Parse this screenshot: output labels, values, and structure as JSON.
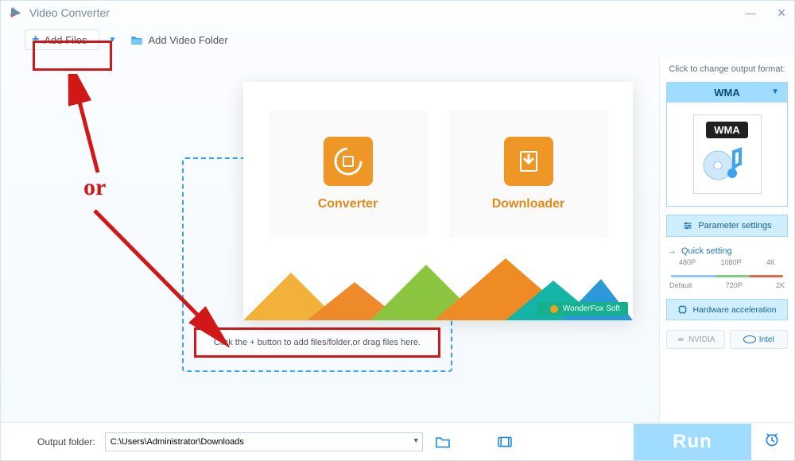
{
  "title": "Video Converter",
  "toolbar": {
    "add_files": "Add Files",
    "add_video_folder": "Add Video Folder"
  },
  "dropzone_hint": "Click the + button to add files/folder,or drag files here.",
  "welcome": {
    "converter": "Converter",
    "downloader": "Downloader",
    "brand": "WonderFox Soft"
  },
  "right": {
    "hint": "Click to change output format:",
    "format_label": "WMA",
    "format_badge": "WMA",
    "param_settings": "Parameter settings",
    "quick_setting": "Quick setting",
    "q_top": [
      "480P",
      "1080P",
      "4K"
    ],
    "q_bottom": [
      "Default",
      "720P",
      "2K"
    ],
    "hw_accel": "Hardware acceleration",
    "nvidia": "NVIDIA",
    "intel": "Intel"
  },
  "bottom": {
    "label": "Output folder:",
    "path": "C:\\Users\\Administrator\\Downloads",
    "run": "Run"
  },
  "annotation_or": "or"
}
